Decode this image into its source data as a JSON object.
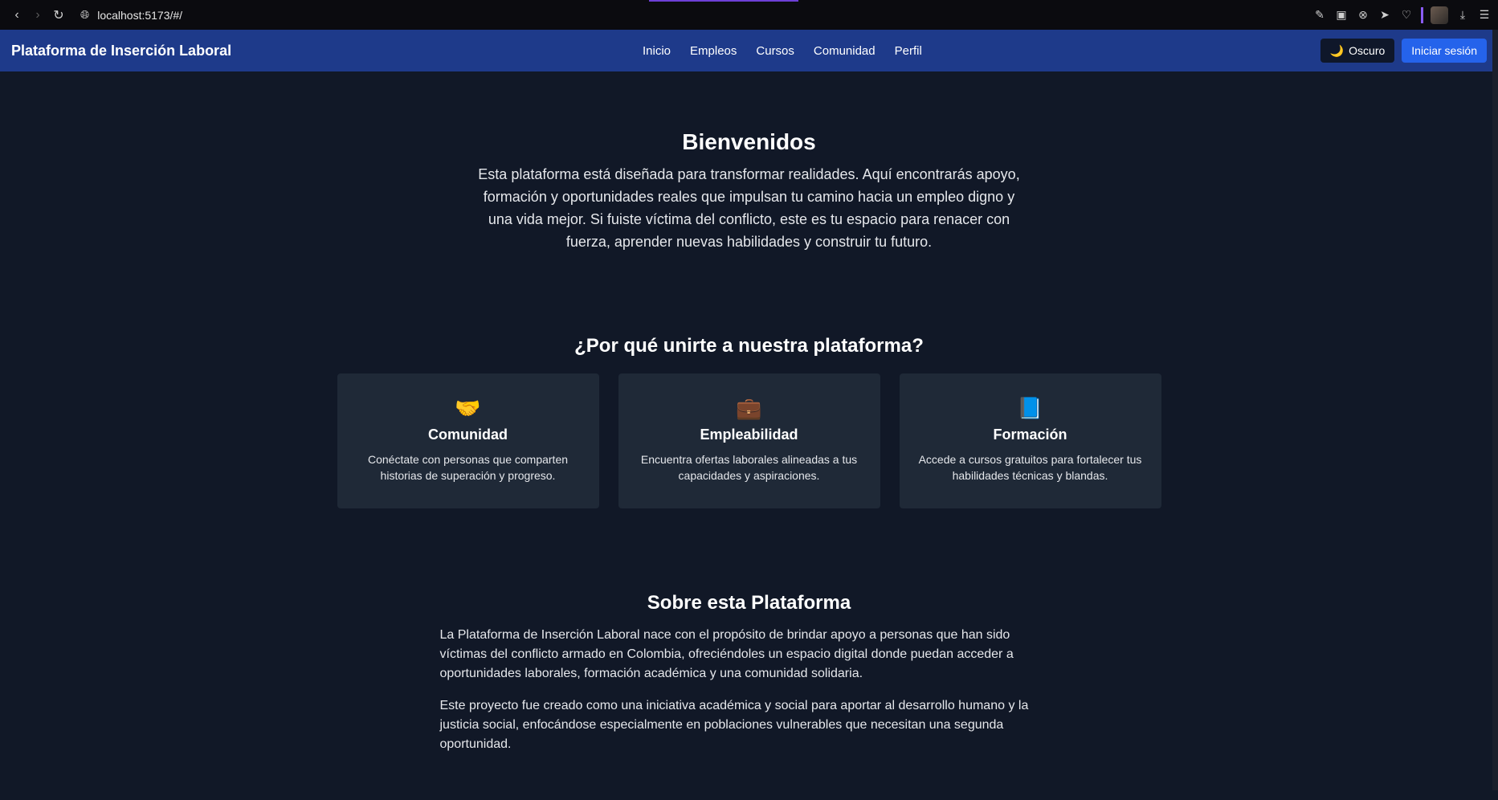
{
  "browser": {
    "url": "localhost:5173/#/"
  },
  "navbar": {
    "brand": "Plataforma de Inserción Laboral",
    "links": [
      "Inicio",
      "Empleos",
      "Cursos",
      "Comunidad",
      "Perfil"
    ],
    "theme_icon": "🌙",
    "theme_label": "Oscuro",
    "login_label": "Iniciar sesión"
  },
  "hero": {
    "title": "Bienvenidos",
    "text": "Esta plataforma está diseñada para transformar realidades. Aquí encontrarás apoyo, formación y oportunidades reales que impulsan tu camino hacia un empleo digno y una vida mejor. Si fuiste víctima del conflicto, este es tu espacio para renacer con fuerza, aprender nuevas habilidades y construir tu futuro."
  },
  "why": {
    "title": "¿Por qué unirte a nuestra plataforma?",
    "cards": [
      {
        "icon": "🤝",
        "title": "Comunidad",
        "text": "Conéctate con personas que comparten historias de superación y progreso."
      },
      {
        "icon": "💼",
        "title": "Empleabilidad",
        "text": "Encuentra ofertas laborales alineadas a tus capacidades y aspiraciones."
      },
      {
        "icon": "📘",
        "title": "Formación",
        "text": "Accede a cursos gratuitos para fortalecer tus habilidades técnicas y blandas."
      }
    ]
  },
  "about": {
    "title": "Sobre esta Plataforma",
    "paragraphs": [
      "La Plataforma de Inserción Laboral nace con el propósito de brindar apoyo a personas que han sido víctimas del conflicto armado en Colombia, ofreciéndoles un espacio digital donde puedan acceder a oportunidades laborales, formación académica y una comunidad solidaria.",
      "Este proyecto fue creado como una iniciativa académica y social para aportar al desarrollo humano y la justicia social, enfocándose especialmente en poblaciones vulnerables que necesitan una segunda oportunidad."
    ]
  }
}
